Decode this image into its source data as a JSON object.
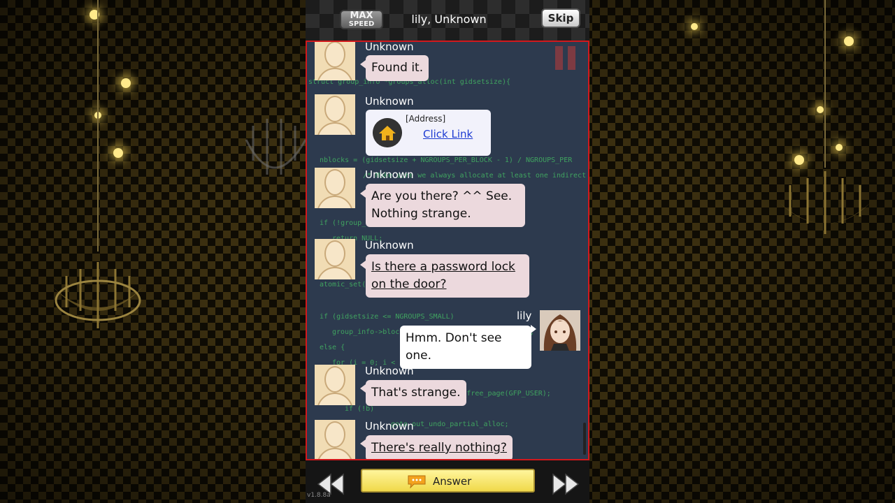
{
  "header": {
    "max_speed_line1": "MAX",
    "max_speed_line2": "SPEED",
    "title": "lily, Unknown",
    "skip_label": "Skip"
  },
  "background_code": [
    "struct group_info *groups_alloc(int gidsetsize){",
    "nblocks = (gidsetsize + NGROUPS_PER_BLOCK - 1) / NGROUPS_PER",
    "/* Make sure we always allocate at least one indirect block pointer */",
    "if (!group_info)",
    "return NULL;",
    "atomic_set(&group_info->usage, 1);",
    "if (gidsetsize <= NGROUPS_SMALL)",
    "group_info->blocks[0] = group_info->small_block;",
    "else {",
    "for (i = 0; i < nblocks; i++) {",
    "b = (void *)__get_free_page(GFP_USER);",
    "if (!b)",
    "goto out_undo_partial_alloc;"
  ],
  "messages": [
    {
      "sender": "Unknown",
      "text": "Found it."
    },
    {
      "sender": "Unknown",
      "card_label": "[Address]",
      "link_text": "Click Link"
    },
    {
      "sender": "Unknown",
      "line1": "Are you there? ^^ See.",
      "line2": "Nothing strange."
    },
    {
      "sender": "Unknown",
      "line1": "Is there a password lock",
      "line2": "on the door?"
    },
    {
      "sender": "lily",
      "text": "Hmm. Don't see one."
    },
    {
      "sender": "Unknown",
      "text": "That's strange."
    },
    {
      "sender": "Unknown",
      "text": "There's really nothing?"
    }
  ],
  "footer": {
    "answer_label": "Answer",
    "version": "v1.8.8a"
  },
  "colors": {
    "chat_border": "#d2181c",
    "unknown_bubble": "#ecd9dd",
    "lily_bubble": "#ffffff",
    "code_text": "#4be06a",
    "answer_button": "#f5e36a"
  },
  "icons": [
    "pause-icon",
    "home-icon",
    "rewind-icon",
    "fast-forward-icon",
    "speech-bubble-icon"
  ]
}
